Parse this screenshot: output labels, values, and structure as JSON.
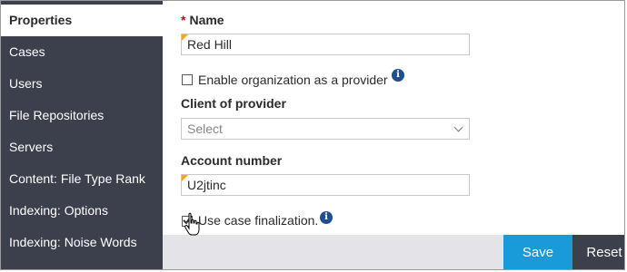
{
  "sidebar": {
    "items": [
      {
        "label": "Properties",
        "active": true
      },
      {
        "label": "Cases"
      },
      {
        "label": "Users"
      },
      {
        "label": "File Repositories"
      },
      {
        "label": "Servers"
      },
      {
        "label": "Content: File Type Rank"
      },
      {
        "label": "Indexing: Options"
      },
      {
        "label": "Indexing: Noise Words"
      }
    ]
  },
  "form": {
    "name": {
      "required_mark": "*",
      "label": "Name",
      "value": "Red Hill"
    },
    "enable_provider": {
      "label": "Enable organization as a provider",
      "checked": false,
      "info_icon": "info-icon"
    },
    "client_of_provider": {
      "label": "Client of provider",
      "selected": "Select"
    },
    "account_number": {
      "label": "Account number",
      "value": "U2jtinc"
    },
    "case_finalization": {
      "label": "Use case finalization.",
      "checked": true,
      "info_icon": "info-icon"
    }
  },
  "footer": {
    "save_label": "Save",
    "reset_label": "Reset"
  },
  "colors": {
    "sidebar_bg": "#3c3f4c",
    "accent_blue": "#1a9ad8",
    "required_red": "#d0021b",
    "info_blue": "#1f4e8c",
    "flag_orange": "#f5a623"
  }
}
